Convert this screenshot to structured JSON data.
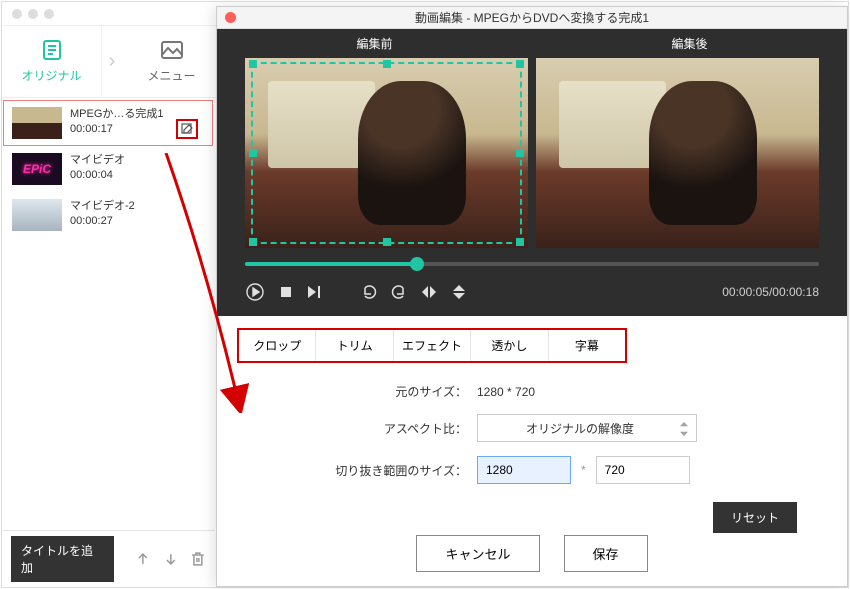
{
  "main": {
    "tabs": {
      "original": "オリジナル",
      "menu": "メニュー"
    },
    "clips": [
      {
        "name": "MPEGか…る完成1",
        "duration": "00:00:17"
      },
      {
        "name": "マイビデオ",
        "duration": "00:00:04"
      },
      {
        "name": "マイビデオ-2",
        "duration": "00:00:27"
      }
    ],
    "add_title": "タイトルを追加"
  },
  "editor": {
    "title": "動画編集 - MPEGからDVDへ変換する完成1",
    "before": "編集前",
    "after": "編集後",
    "timecode": "00:00:05/00:00:18",
    "tabs": {
      "crop": "クロップ",
      "trim": "トリム",
      "effect": "エフェクト",
      "watermark": "透かし",
      "subtitle": "字幕"
    },
    "form": {
      "orig_size_label": "元のサイズ：",
      "orig_size_value": "1280 * 720",
      "aspect_label": "アスペクト比：",
      "aspect_value": "オリジナルの解像度",
      "crop_size_label": "切り抜き範囲のサイズ：",
      "crop_w": "1280",
      "crop_h": "720"
    },
    "reset": "リセット",
    "cancel": "キャンセル",
    "save": "保存"
  },
  "thumb2_text": "EPiC"
}
